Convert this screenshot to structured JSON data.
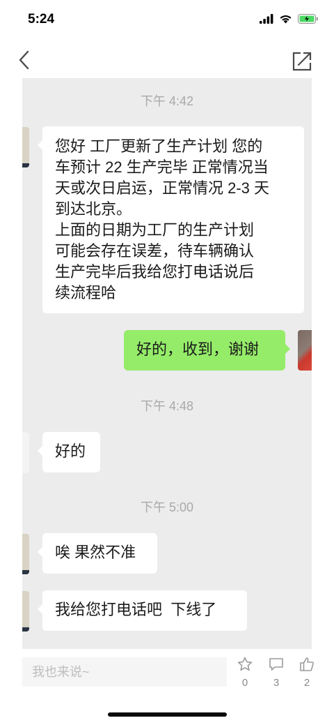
{
  "status_bar": {
    "time": "5:24",
    "icons": [
      "signal-icon",
      "wifi-icon",
      "battery-icon"
    ],
    "battery_color": "#4cd964"
  },
  "nav": {
    "back_icon": "chevron-left-icon",
    "share_icon": "share-icon"
  },
  "chat": {
    "timestamps": [
      "下午 4:42",
      "下午 4:48",
      "下午 5:00"
    ],
    "messages": [
      {
        "side": "left",
        "text": "您好 工厂更新了生产计划 您的\n车预计 22 生产完毕 正常情况当\n天或次日启运，正常情况 2-3 天\n到达北京。\n上面的日期为工厂的生产计划\n可能会存在误差，待车辆确认\n生产完毕后我给您打电话说后\n续流程哈"
      },
      {
        "side": "right",
        "text": "好的，收到，谢谢"
      },
      {
        "side": "left",
        "text": "好的"
      },
      {
        "side": "left",
        "text": "唉 果然不准"
      },
      {
        "side": "left",
        "text": "我给您打电话吧  下线了"
      }
    ],
    "colors": {
      "background": "#ececec",
      "bubble_left": "#ffffff",
      "bubble_right": "#95ec69",
      "timestamp": "#a9a9a9"
    }
  },
  "bottom_bar": {
    "comment_placeholder": "我也来说~",
    "actions": [
      {
        "icon": "star-icon",
        "count": "0"
      },
      {
        "icon": "comment-icon",
        "count": "3"
      },
      {
        "icon": "thumbs-up-icon",
        "count": "2"
      }
    ]
  }
}
